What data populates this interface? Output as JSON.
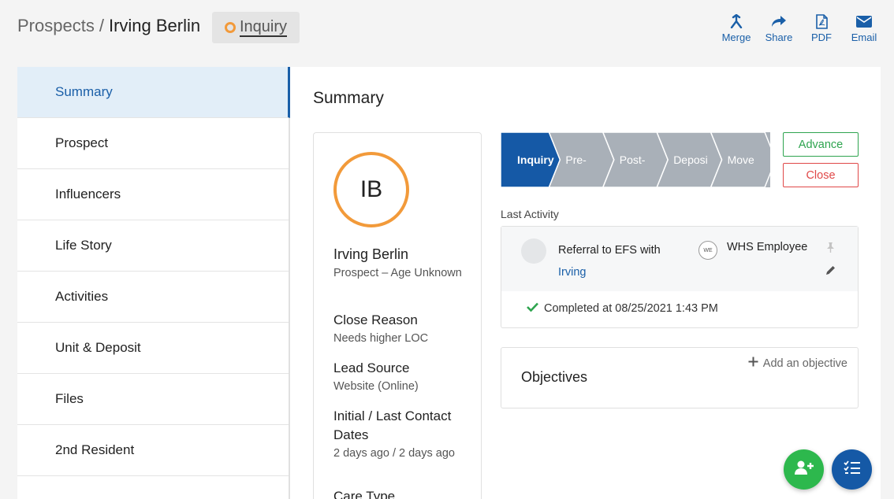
{
  "header": {
    "breadcrumb_parent": "Prospects",
    "breadcrumb_sep": "/",
    "breadcrumb_current": "Irving Berlin",
    "status": "Inquiry",
    "status_color": "#f29a3a",
    "actions": [
      {
        "label": "Merge",
        "icon": "merge-icon"
      },
      {
        "label": "Share",
        "icon": "share-icon"
      },
      {
        "label": "PDF",
        "icon": "pdf-icon"
      },
      {
        "label": "Email",
        "icon": "email-icon"
      }
    ]
  },
  "sidebar": {
    "items": [
      {
        "label": "Summary",
        "active": true
      },
      {
        "label": "Prospect"
      },
      {
        "label": "Influencers"
      },
      {
        "label": "Life Story"
      },
      {
        "label": "Activities"
      },
      {
        "label": "Unit & Deposit"
      },
      {
        "label": "Files"
      },
      {
        "label": "2nd Resident"
      }
    ]
  },
  "main": {
    "title": "Summary",
    "profile": {
      "initials": "IB",
      "name": "Irving Berlin",
      "subtitle": "Prospect – Age Unknown",
      "fields": [
        {
          "label": "Close Reason",
          "value": "Needs higher LOC"
        },
        {
          "label": "Lead Source",
          "value": "Website (Online)"
        },
        {
          "label": "Initial / Last Contact Dates",
          "value": "2 days ago / 2 days ago"
        },
        {
          "label": "Care Type",
          "value": ""
        }
      ]
    },
    "pipeline": {
      "stages": [
        "Inquiry",
        "Pre-",
        "Post-",
        "Deposi",
        "Move"
      ],
      "active_index": 0,
      "active_color": "#1559a6",
      "inactive_color": "#a9b0b8"
    },
    "advance_label": "Advance",
    "close_label": "Close",
    "last_activity": {
      "label": "Last Activity",
      "text": "Referral to EFS with",
      "link": "Irving",
      "employee_initials": "WE",
      "employee_name": "WHS Employee",
      "completed": "Completed at 08/25/2021 1:43 PM"
    },
    "objectives": {
      "title": "Objectives",
      "add_label": "Add an objective"
    }
  },
  "fabs": [
    {
      "icon": "add-person-icon",
      "color": "#2db84d"
    },
    {
      "icon": "checklist-icon",
      "color": "#1559a6"
    }
  ]
}
